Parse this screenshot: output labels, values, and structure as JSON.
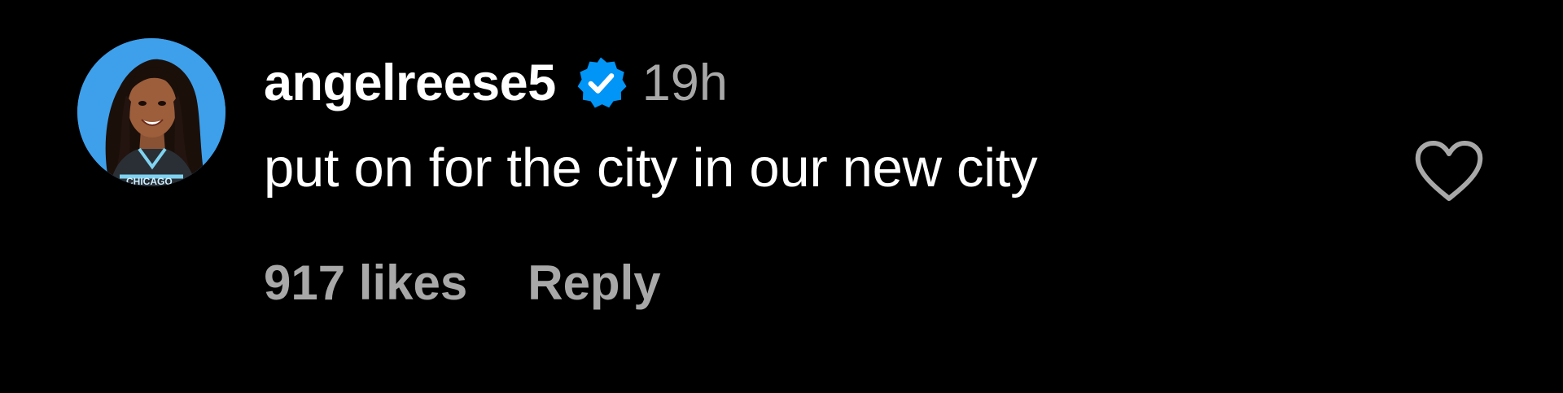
{
  "comment": {
    "username": "angelreese5",
    "verified": true,
    "time_ago": "19h",
    "text": "put on for the city in our new city",
    "likes_label": "917 likes",
    "reply_label": "Reply",
    "like_icon": "heart-outline-icon",
    "verified_icon": "verified-badge-icon"
  },
  "colors": {
    "background": "#000000",
    "primary_text": "#ffffff",
    "secondary_text": "#a8a8a8",
    "verified_badge": "#0095f6",
    "avatar_background": "#3ea0ea"
  }
}
